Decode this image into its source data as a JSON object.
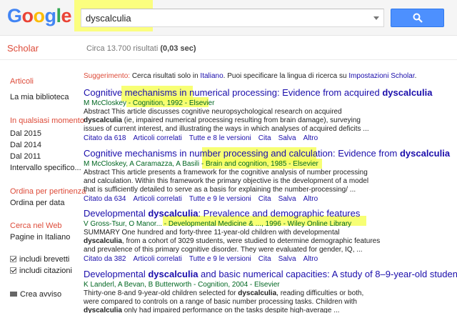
{
  "header": {
    "logo": [
      "G",
      "o",
      "o",
      "g",
      "l",
      "e"
    ],
    "logo_colors": [
      "#4285f4",
      "#ea4335",
      "#fbbc05",
      "#4285f4",
      "#34a853",
      "#ea4335"
    ],
    "search_value": "dyscalculia",
    "search_icon": "search-icon"
  },
  "subheader": {
    "scholar": "Scholar",
    "count": "Circa 13.700 risultati",
    "time": "(0,03 sec)"
  },
  "sidebar": {
    "articles": "Articoli",
    "library": "La mia biblioteca",
    "any_time": "In qualsiasi momento",
    "since_2015": "Dal 2015",
    "since_2014": "Dal 2014",
    "since_2011": "Dal 2011",
    "custom_range": "Intervallo specifico...",
    "sort_relevance": "Ordina per pertinenza",
    "sort_date": "Ordina per data",
    "search_web": "Cerca nel Web",
    "italian_pages": "Pagine in Italiano",
    "include_patents": "includi brevetti",
    "include_citations": "includi citazioni",
    "create_alert": "Crea avviso"
  },
  "suggestion": {
    "label": "Suggerimento:",
    "text1": "Cerca risultati solo in",
    "lang": "Italiano",
    "text2": ". Puoi specificare la lingua di ricerca su",
    "settings": "Impostazioni Scholar",
    "end": "."
  },
  "results": [
    {
      "title_pre": "Cognitive mechanisms in numerical processing: Evidence from acquired ",
      "title_bold": "dyscalculia",
      "title_post": "",
      "authors": "M McCloskey",
      "source": " - Cognition, 1992 - Elsevier",
      "abs1": "Abstract This article discusses cognitive neuropsychological research on acquired",
      "abs2_bold": "dyscalculia",
      "abs2": " (ie, impaired numerical processing resulting from brain damage), surveying",
      "abs3": "issues of current interest, and illustrating the ways in which analyses of acquired deficits ...",
      "cited": "Citato da 618",
      "related": "Articoli correlati",
      "versions": "Tutte e 8 le versioni",
      "cite": "Cita",
      "save": "Salva",
      "more": "Altro"
    },
    {
      "title_pre": "Cognitive mechanisms in number processing and calculation: Evidence from ",
      "title_bold": "dyscalculia",
      "title_post": "",
      "authors": "M McCloskey, A Caramazza, A Basili",
      "source": " - Brain and cognition, 1985 - Elsevier",
      "abs1": "Abstract This article presents a framework for the cognitive analysis of number processing",
      "abs2_bold": "",
      "abs2": "and calculation. Within this framework the primary objective is the development of a model",
      "abs3": "that is sufficiently detailed to serve as a basis for explaining the number-processing/ ...",
      "cited": "Citato da 634",
      "related": "Articoli correlati",
      "versions": "Tutte e 9 le versioni",
      "cite": "Cita",
      "save": "Salva",
      "more": "Altro"
    },
    {
      "title_pre": "Developmental ",
      "title_bold": "dyscalculia",
      "title_post": ": Prevalence and demographic features",
      "authors": "V Gross-Tsur, O Manor...",
      "source": " - Developmental Medicine & ..., 1996 - Wiley Online Library",
      "abs1": "SUMMARY One hundred and forty-three 11-year-old children with developmental",
      "abs2_bold": "dyscalculia",
      "abs2": ", from a cohort of 3029 students, were studied to determine demographic features",
      "abs3": "and prevalence of this primary cognitive disorder. They were evaluated for gender, IQ, ...",
      "cited": "Citato da 382",
      "related": "Articoli correlati",
      "versions": "Tutte e 9 le versioni",
      "cite": "Cita",
      "save": "Salva",
      "more": "Altro"
    },
    {
      "title_pre": "Developmental ",
      "title_bold": "dyscalculia",
      "title_post": " and basic numerical capacities: A study of 8–9-year-old students",
      "authors": "K Landerl, A Bevan, B Butterworth",
      "source": " - Cognition, 2004 - Elsevier",
      "abs1_pre": "Thirty-one 8-and 9-year-old children selected for ",
      "abs1_bold": "dyscalculia",
      "abs1_post": ", reading difficulties or both,",
      "abs2": "were compared to controls on a range of basic number processing tasks. Children with",
      "abs3_bold": "dyscalculia",
      "abs3": " only had impaired performance on the tasks despite high-average ..."
    }
  ]
}
